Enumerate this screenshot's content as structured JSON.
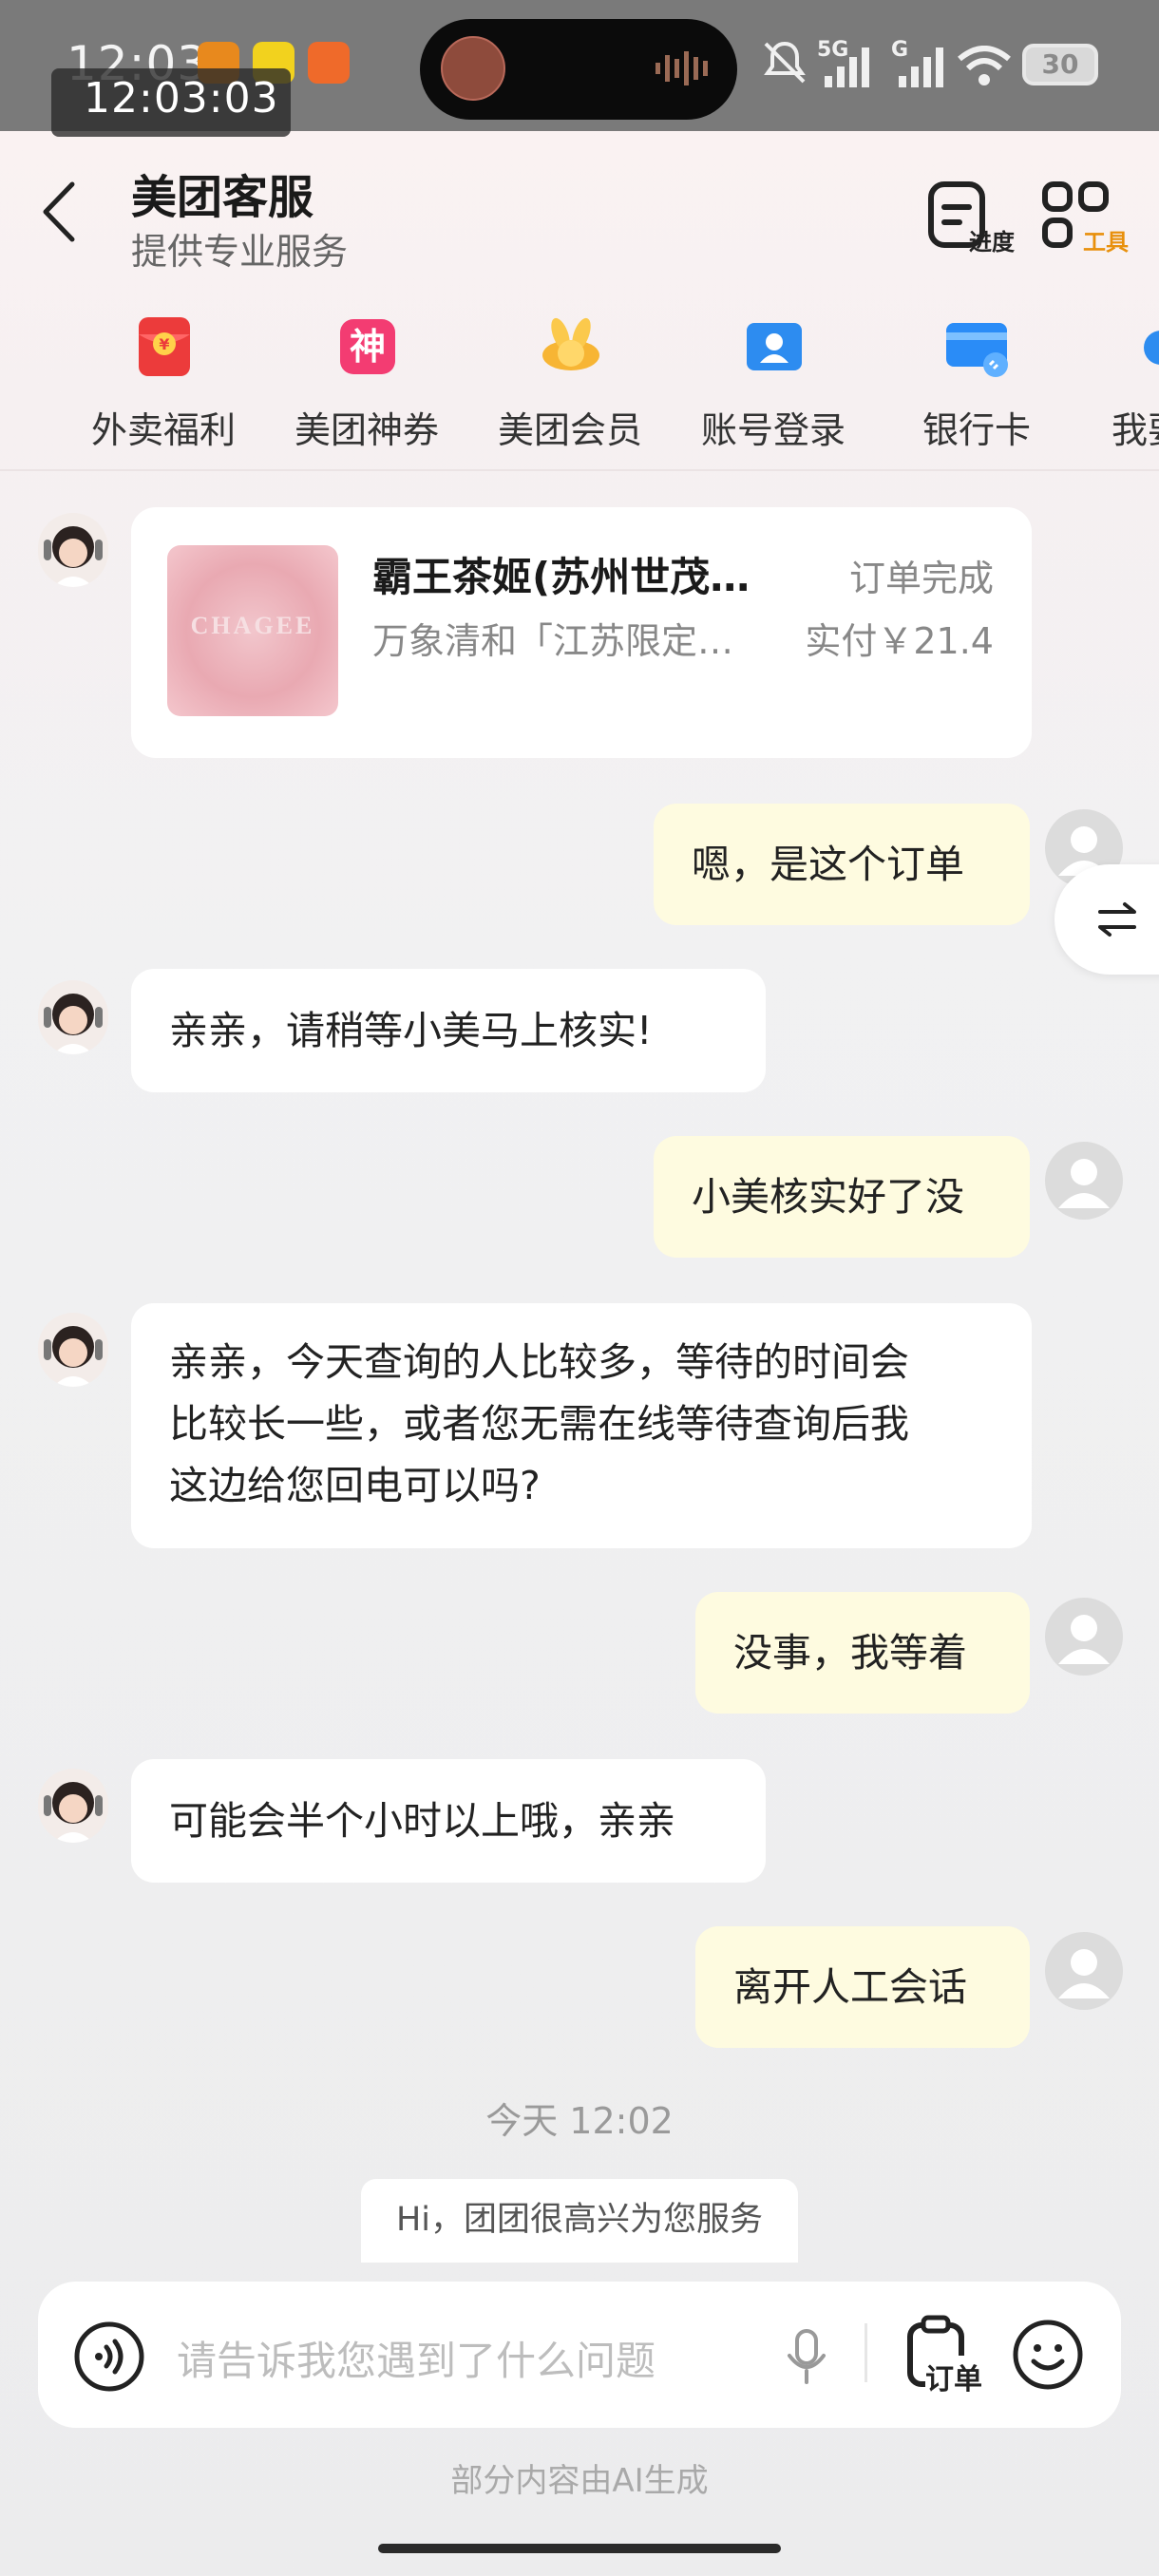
{
  "status_bar": {
    "time": "12:03",
    "overlay_time": "12:03:03",
    "network": "5G",
    "network2": "G",
    "battery": "30"
  },
  "header": {
    "title": "美团客服",
    "subtitle": "提供专业服务",
    "progress_label": "进度",
    "tools_label": "工具"
  },
  "shortcuts": [
    {
      "label": "外卖福利",
      "icon": "red-envelope-icon"
    },
    {
      "label": "美团神券",
      "icon": "coupon-icon",
      "glyph": "神"
    },
    {
      "label": "美团会员",
      "icon": "member-mascot-icon"
    },
    {
      "label": "账号登录",
      "icon": "account-icon"
    },
    {
      "label": "银行卡",
      "icon": "bank-card-icon"
    },
    {
      "label": "我要",
      "icon": "more-icon"
    }
  ],
  "order": {
    "shop": "霸王茶姬(苏州世茂…",
    "status": "订单完成",
    "item": "万象清和「江苏限定…",
    "paid": "实付￥21.4",
    "brand": "CHAGEE"
  },
  "messages": [
    {
      "from": "user",
      "text": "嗯，是这个订单"
    },
    {
      "from": "agent",
      "text": "亲亲，请稍等小美马上核实!"
    },
    {
      "from": "user",
      "text": "小美核实好了没"
    },
    {
      "from": "agent",
      "lines": [
        "亲亲，今天查询的人比较多，等待的时间会",
        "比较长一些，或者您无需在线等待查询后我",
        "这边给您回电可以吗?"
      ]
    },
    {
      "from": "user",
      "text": "没事，我等着"
    },
    {
      "from": "agent",
      "text": "可能会半个小时以上哦，亲亲"
    },
    {
      "from": "user",
      "text": "离开人工会话"
    }
  ],
  "timestamp": "今天 12:02",
  "system_greeting": "Hi，团团很高兴为您服务",
  "input": {
    "placeholder": "请告诉我您遇到了什么问题",
    "order_label": "订单"
  },
  "footnote": "部分内容由AI生成",
  "colors": {
    "accent_orange": "#e8900c",
    "user_bubble": "#fefbe0",
    "status_bar": "#7a7a7a"
  }
}
